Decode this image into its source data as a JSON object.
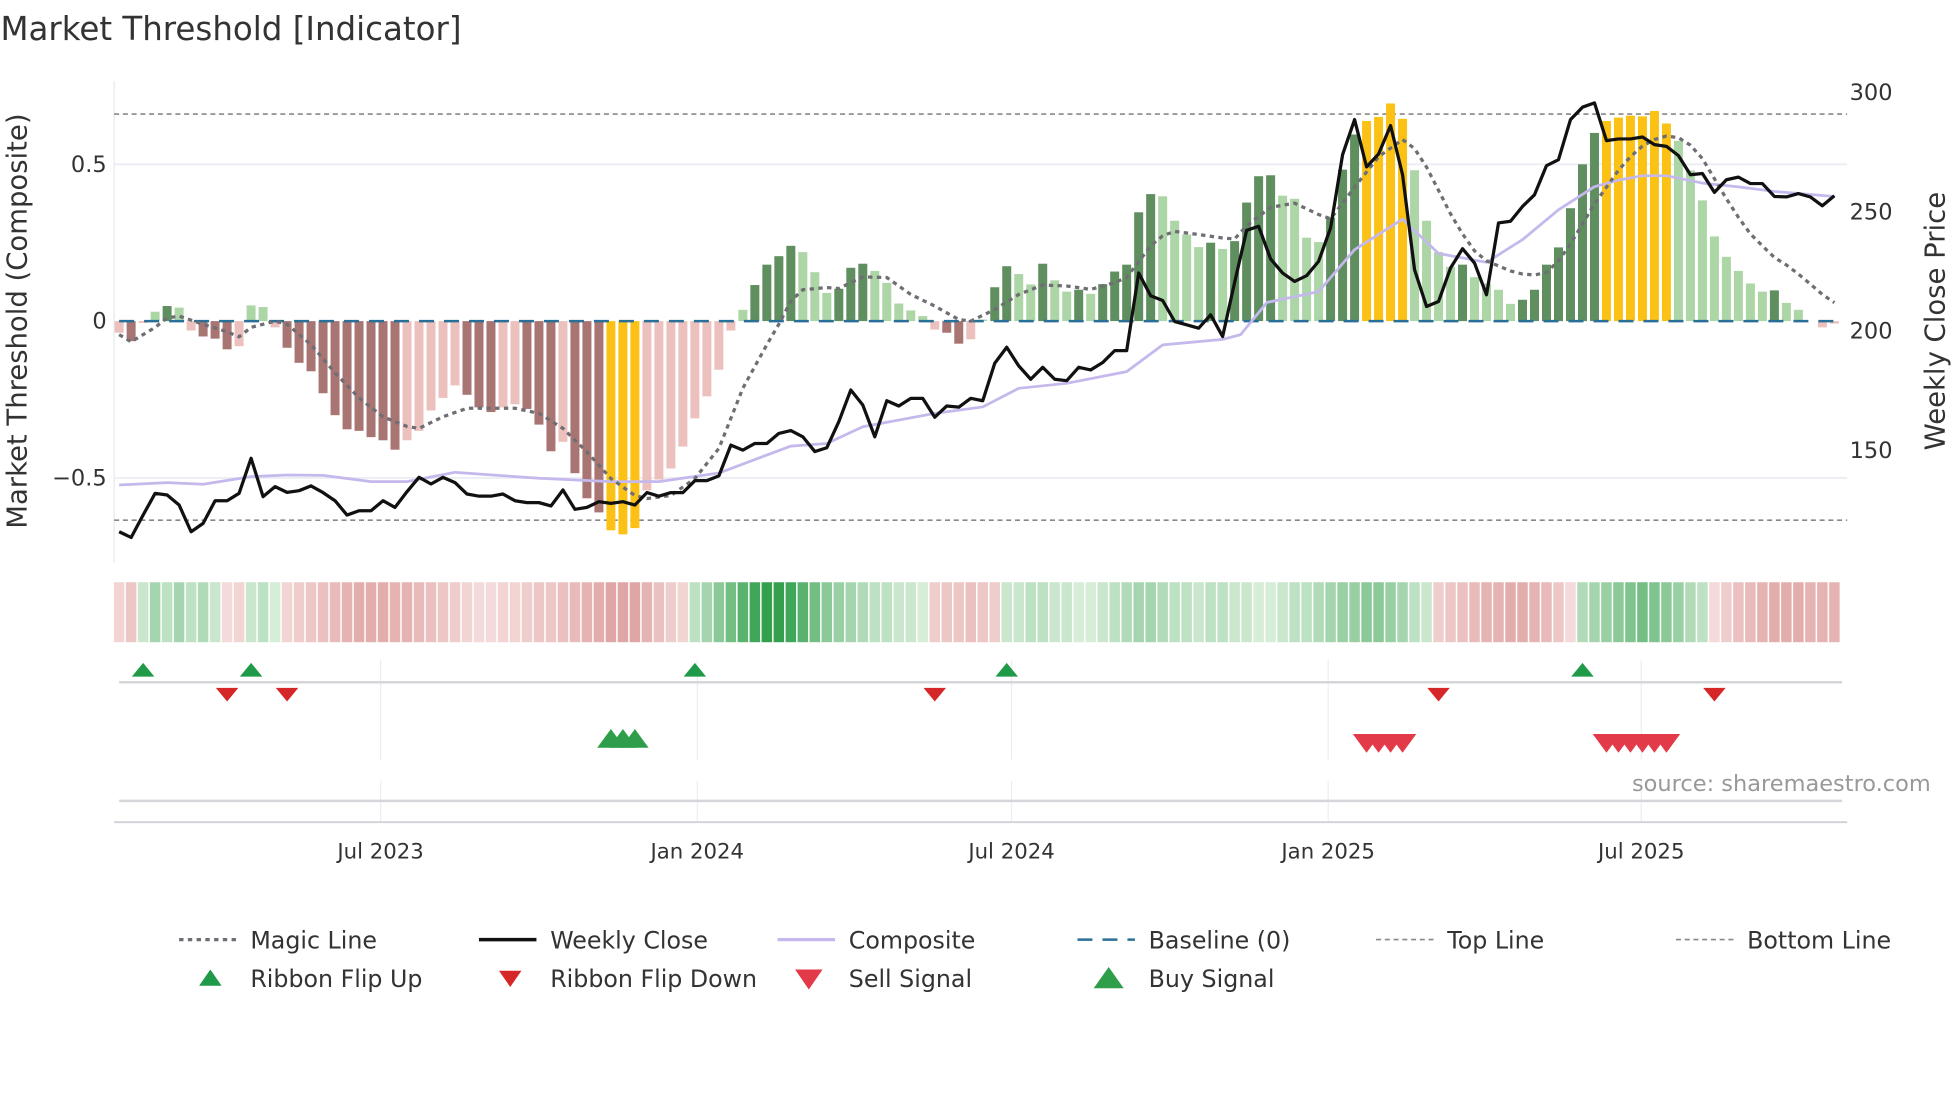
{
  "title": "Market Threshold [Indicator]",
  "source": "source: sharemaestro.com",
  "colors": {
    "dark_green": "#5f8f5f",
    "light_green": "#acd6a5",
    "dark_red": "#a87572",
    "light_red": "#ecc0bc",
    "extreme": "#fbc215",
    "weekly_close": "#111111",
    "composite": "#c4b8ec",
    "magic": "#6e6e74",
    "baseline": "#2a6f97",
    "threshold": "#888888",
    "flip_up": "#1f9a48",
    "flip_down": "#d62728",
    "sell": "#e23a48",
    "buy": "#2e9e4a"
  },
  "chart_data": {
    "type": "bar+line",
    "title": "Market Threshold [Indicator]",
    "ylabel_left": "Market Threshold (Composite)",
    "ylabel_right": "Weekly Close Price",
    "ylim_left": [
      -0.77,
      0.77
    ],
    "ylim_right": [
      113,
      313
    ],
    "left_ticks": [
      {
        "label": "0.5",
        "value": 0.5
      },
      {
        "label": "0",
        "value": 0
      },
      {
        "label": "−0.5",
        "value": -0.5
      }
    ],
    "right_ticks": [
      {
        "label": "300",
        "value": 300
      },
      {
        "label": "250",
        "value": 250
      },
      {
        "label": "200",
        "value": 200
      },
      {
        "label": "150",
        "value": 150
      }
    ],
    "x_ticks": [
      {
        "label": "Jul 2023",
        "week": 22.8
      },
      {
        "label": "Jan 2024",
        "week": 49.2
      },
      {
        "label": "Jul 2024",
        "week": 75.4
      },
      {
        "label": "Jan 2025",
        "week": 101.8
      },
      {
        "label": "Jul 2025",
        "week": 127.9
      }
    ],
    "weeks": 144,
    "top_line": 0.66,
    "bottom_line": -0.635,
    "baseline": 0,
    "histogram": [
      -0.037,
      -0.064,
      -0.006,
      0.03,
      0.048,
      0.043,
      -0.03,
      -0.049,
      -0.056,
      -0.09,
      -0.08,
      0.05,
      0.045,
      -0.02,
      -0.085,
      -0.133,
      -0.16,
      -0.23,
      -0.3,
      -0.345,
      -0.35,
      -0.37,
      -0.38,
      -0.41,
      -0.38,
      -0.35,
      -0.285,
      -0.245,
      -0.205,
      -0.235,
      -0.275,
      -0.29,
      -0.275,
      -0.265,
      -0.28,
      -0.33,
      -0.415,
      -0.385,
      -0.485,
      -0.565,
      -0.61,
      -0.667,
      -0.68,
      -0.66,
      -0.54,
      -0.505,
      -0.47,
      -0.4,
      -0.31,
      -0.24,
      -0.155,
      -0.03,
      0.036,
      0.115,
      0.18,
      0.207,
      0.24,
      0.22,
      0.156,
      0.09,
      0.103,
      0.17,
      0.183,
      0.16,
      0.122,
      0.056,
      0.034,
      0.016,
      -0.027,
      -0.037,
      -0.072,
      -0.058,
      0.005,
      0.108,
      0.175,
      0.15,
      0.117,
      0.183,
      0.13,
      0.094,
      0.1,
      0.087,
      0.118,
      0.158,
      0.18,
      0.347,
      0.405,
      0.398,
      0.32,
      0.276,
      0.236,
      0.25,
      0.23,
      0.255,
      0.378,
      0.462,
      0.465,
      0.4,
      0.39,
      0.266,
      0.252,
      0.33,
      0.483,
      0.595,
      0.638,
      0.651,
      0.694,
      0.645,
      0.481,
      0.32,
      0.22,
      0.173,
      0.18,
      0.14,
      0.12,
      0.1,
      0.055,
      0.068,
      0.1,
      0.18,
      0.235,
      0.36,
      0.5,
      0.6,
      0.638,
      0.649,
      0.655,
      0.653,
      0.67,
      0.63,
      0.575,
      0.48,
      0.385,
      0.27,
      0.205,
      0.16,
      0.12,
      0.094,
      0.098,
      0.058,
      0.036,
      0,
      -0.02,
      -0.008
    ],
    "histogram_state": [
      "lr",
      "dr",
      "lr",
      "lg",
      "dg",
      "lg",
      "lr",
      "dr",
      "dr",
      "dr",
      "lr",
      "lg",
      "lg",
      "lr",
      "dr",
      "dr",
      "dr",
      "dr",
      "dr",
      "dr",
      "dr",
      "dr",
      "dr",
      "dr",
      "lr",
      "lr",
      "lr",
      "lr",
      "lr",
      "dr",
      "dr",
      "dr",
      "lr",
      "lr",
      "dr",
      "dr",
      "dr",
      "lr",
      "dr",
      "dr",
      "dr",
      "y",
      "y",
      "y",
      "lr",
      "lr",
      "lr",
      "lr",
      "lr",
      "lr",
      "lr",
      "lr",
      "lg",
      "dg",
      "dg",
      "dg",
      "dg",
      "lg",
      "lg",
      "lg",
      "dg",
      "dg",
      "dg",
      "lg",
      "lg",
      "lg",
      "lg",
      "lg",
      "lr",
      "dr",
      "dr",
      "lr",
      "lg",
      "dg",
      "dg",
      "lg",
      "lg",
      "dg",
      "lg",
      "lg",
      "dg",
      "lg",
      "dg",
      "dg",
      "dg",
      "dg",
      "dg",
      "lg",
      "lg",
      "lg",
      "lg",
      "dg",
      "lg",
      "dg",
      "dg",
      "dg",
      "dg",
      "lg",
      "lg",
      "lg",
      "lg",
      "dg",
      "dg",
      "dg",
      "y",
      "y",
      "y",
      "y",
      "lg",
      "lg",
      "lg",
      "lg",
      "dg",
      "lg",
      "lg",
      "lg",
      "lg",
      "dg",
      "dg",
      "dg",
      "dg",
      "dg",
      "dg",
      "dg",
      "y",
      "y",
      "y",
      "y",
      "y",
      "y",
      "lg",
      "lg",
      "lg",
      "lg",
      "lg",
      "lg",
      "lg",
      "lg",
      "dg",
      "lg",
      "lg",
      "lg",
      "lr",
      "lr"
    ],
    "weekly_close": [
      115.4,
      113,
      122.4,
      131.5,
      130.8,
      126.6,
      115.4,
      118.9,
      128.4,
      128.4,
      131.5,
      146.2,
      130.1,
      134.3,
      131.9,
      132.6,
      134.6,
      131.8,
      128.4,
      122.4,
      124.2,
      124.2,
      128.4,
      125.6,
      132.2,
      138.2,
      135.4,
      138.2,
      136,
      131.2,
      130.3,
      130.3,
      131.2,
      128.4,
      127.6,
      127.6,
      126.2,
      132.9,
      124.8,
      125.6,
      128,
      127.3,
      128,
      126.6,
      131.8,
      130.3,
      131.8,
      131.8,
      136.8,
      136.8,
      138.8,
      151.7,
      149.6,
      152.4,
      152.4,
      156.6,
      157.8,
      155.2,
      149,
      150.6,
      161.5,
      174.8,
      168.5,
      155.2,
      170.3,
      168.1,
      171.3,
      171.3,
      163.4,
      168.1,
      167.6,
      171.3,
      170.3,
      186,
      192.7,
      184.9,
      179.3,
      184.3,
      179.3,
      178.7,
      184.3,
      183.2,
      186.3,
      191.3,
      191.3,
      223.8,
      214.3,
      212.3,
      203.5,
      202.1,
      200.7,
      206.3,
      197.2,
      219.9,
      241.7,
      243.4,
      229.7,
      223.8,
      220.3,
      222.7,
      228.7,
      242.7,
      273.4,
      288.1,
      268.3,
      273.7,
      285.6,
      265,
      225.2,
      209.8,
      211.9,
      225.9,
      234,
      228,
      214.7,
      244.8,
      245.5,
      251.7,
      256.6,
      268.8,
      271.3,
      288.1,
      293.3,
      295.1,
      279.3,
      280,
      280,
      280.8,
      277.6,
      276.9,
      273,
      265,
      265.5,
      257.6,
      262.9,
      264,
      261.3,
      261.3,
      255.9,
      255.7,
      257.1,
      255.7,
      252,
      256.2
    ],
    "composite": [
      [
        1,
        135
      ],
      [
        5,
        136
      ],
      [
        8,
        135.3
      ],
      [
        12,
        138.5
      ],
      [
        15,
        139.2
      ],
      [
        18,
        139
      ],
      [
        22,
        136.4
      ],
      [
        25,
        136.4
      ],
      [
        29,
        140.3
      ],
      [
        36,
        137.8
      ],
      [
        42,
        136.4
      ],
      [
        46,
        136.4
      ],
      [
        51,
        140
      ],
      [
        57,
        151.3
      ],
      [
        60,
        152.4
      ],
      [
        63,
        159.4
      ],
      [
        69,
        165
      ],
      [
        73,
        167.7
      ],
      [
        76,
        175.5
      ],
      [
        80,
        177.6
      ],
      [
        85,
        182.5
      ],
      [
        88,
        193.7
      ],
      [
        93,
        196
      ],
      [
        94.5,
        198
      ],
      [
        96.7,
        211.5
      ],
      [
        101,
        216
      ],
      [
        104,
        233.6
      ],
      [
        108,
        246.4
      ],
      [
        111,
        232
      ],
      [
        115,
        228.3
      ],
      [
        118,
        237.8
      ],
      [
        121,
        250.3
      ],
      [
        124,
        260
      ],
      [
        126,
        262.7
      ],
      [
        128,
        264.6
      ],
      [
        130,
        264.6
      ],
      [
        133,
        261.5
      ],
      [
        136,
        259.9
      ],
      [
        139,
        258
      ],
      [
        144,
        255.9
      ]
    ],
    "magic_line": [
      [
        1,
        -0.043
      ],
      [
        2,
        -0.066
      ],
      [
        4,
        -0.02
      ],
      [
        5,
        0.01
      ],
      [
        6,
        0.016
      ],
      [
        8,
        -0.01
      ],
      [
        10,
        -0.034
      ],
      [
        11,
        -0.05
      ],
      [
        12,
        -0.02
      ],
      [
        14,
        0
      ],
      [
        15,
        -0.01
      ],
      [
        17,
        -0.075
      ],
      [
        19,
        -0.165
      ],
      [
        21,
        -0.245
      ],
      [
        23,
        -0.305
      ],
      [
        25,
        -0.336
      ],
      [
        26,
        -0.342
      ],
      [
        28,
        -0.305
      ],
      [
        30,
        -0.278
      ],
      [
        32,
        -0.278
      ],
      [
        34,
        -0.278
      ],
      [
        36,
        -0.294
      ],
      [
        38,
        -0.342
      ],
      [
        40,
        -0.417
      ],
      [
        42,
        -0.502
      ],
      [
        44,
        -0.556
      ],
      [
        45,
        -0.566
      ],
      [
        47,
        -0.556
      ],
      [
        49,
        -0.502
      ],
      [
        51,
        -0.406
      ],
      [
        53,
        -0.214
      ],
      [
        55,
        -0.075
      ],
      [
        56,
        -0.01
      ],
      [
        57,
        0.064
      ],
      [
        58,
        0.1
      ],
      [
        60,
        0.107
      ],
      [
        61,
        0.104
      ],
      [
        63,
        0.141
      ],
      [
        65,
        0.139
      ],
      [
        67,
        0.085
      ],
      [
        69,
        0.048
      ],
      [
        71,
        0.005
      ],
      [
        72,
        0
      ],
      [
        74,
        0.037
      ],
      [
        76,
        0.085
      ],
      [
        78,
        0.115
      ],
      [
        80,
        0.112
      ],
      [
        82,
        0.101
      ],
      [
        84,
        0.123
      ],
      [
        85,
        0.139
      ],
      [
        87,
        0.24
      ],
      [
        88,
        0.272
      ],
      [
        89,
        0.286
      ],
      [
        91,
        0.276
      ],
      [
        93,
        0.265
      ],
      [
        94,
        0.262
      ],
      [
        95,
        0.304
      ],
      [
        97,
        0.363
      ],
      [
        99,
        0.376
      ],
      [
        101,
        0.34
      ],
      [
        102,
        0.326
      ],
      [
        104,
        0.427
      ],
      [
        106,
        0.524
      ],
      [
        108,
        0.579
      ],
      [
        109,
        0.55
      ],
      [
        110,
        0.491
      ],
      [
        111,
        0.417
      ],
      [
        112,
        0.342
      ],
      [
        113,
        0.278
      ],
      [
        114,
        0.224
      ],
      [
        115,
        0.192
      ],
      [
        116,
        0.176
      ],
      [
        117,
        0.16
      ],
      [
        118,
        0.15
      ],
      [
        119,
        0.147
      ],
      [
        120,
        0.155
      ],
      [
        121,
        0.192
      ],
      [
        122,
        0.246
      ],
      [
        123,
        0.31
      ],
      [
        124,
        0.374
      ],
      [
        125,
        0.427
      ],
      [
        126,
        0.481
      ],
      [
        127,
        0.524
      ],
      [
        128,
        0.558
      ],
      [
        129,
        0.579
      ],
      [
        130,
        0.59
      ],
      [
        131,
        0.585
      ],
      [
        132,
        0.561
      ],
      [
        133,
        0.518
      ],
      [
        134,
        0.454
      ],
      [
        135,
        0.39
      ],
      [
        136,
        0.331
      ],
      [
        137,
        0.278
      ],
      [
        138,
        0.24
      ],
      [
        139,
        0.203
      ],
      [
        140,
        0.179
      ],
      [
        141,
        0.15
      ],
      [
        142,
        0.118
      ],
      [
        143,
        0.085
      ],
      [
        144,
        0.059
      ]
    ],
    "ribbon": [
      -0.25,
      -0.35,
      0.25,
      0.4,
      0.3,
      0.4,
      0.3,
      0.35,
      0.25,
      -0.2,
      -0.25,
      0.25,
      0.3,
      0.2,
      -0.25,
      -0.3,
      -0.35,
      -0.4,
      -0.45,
      -0.5,
      -0.55,
      -0.55,
      -0.55,
      -0.5,
      -0.5,
      -0.45,
      -0.4,
      -0.35,
      -0.3,
      -0.25,
      -0.2,
      -0.2,
      -0.25,
      -0.25,
      -0.3,
      -0.35,
      -0.35,
      -0.4,
      -0.45,
      -0.5,
      -0.55,
      -0.6,
      -0.6,
      -0.6,
      -0.5,
      -0.4,
      -0.3,
      -0.25,
      0.3,
      0.4,
      0.5,
      0.6,
      0.7,
      0.8,
      0.85,
      0.85,
      0.8,
      0.7,
      0.6,
      0.5,
      0.45,
      0.4,
      0.35,
      0.3,
      0.3,
      0.25,
      0.25,
      0.2,
      -0.3,
      -0.35,
      -0.35,
      -0.4,
      -0.35,
      -0.3,
      0.25,
      0.25,
      0.3,
      0.3,
      0.25,
      0.25,
      0.2,
      0.2,
      0.25,
      0.3,
      0.35,
      0.4,
      0.4,
      0.35,
      0.3,
      0.3,
      0.25,
      0.3,
      0.3,
      0.25,
      0.25,
      0.2,
      0.2,
      0.25,
      0.3,
      0.3,
      0.35,
      0.4,
      0.45,
      0.45,
      0.5,
      0.5,
      0.45,
      0.4,
      0.3,
      0.25,
      -0.3,
      -0.35,
      -0.4,
      -0.45,
      -0.5,
      -0.5,
      -0.55,
      -0.55,
      -0.5,
      -0.45,
      -0.35,
      -0.2,
      0.35,
      0.4,
      0.45,
      0.5,
      0.55,
      0.6,
      0.55,
      0.5,
      0.45,
      0.35,
      0.3,
      -0.2,
      -0.3,
      -0.4,
      -0.45,
      -0.5,
      -0.55,
      -0.55,
      -0.55,
      -0.5,
      -0.5,
      -0.5
    ],
    "ribbon_flip_up_weeks": [
      3,
      12,
      49,
      75,
      123
    ],
    "ribbon_flip_down_weeks": [
      10,
      15,
      69,
      111,
      134
    ],
    "buy_signal_weeks": [
      42,
      43,
      44
    ],
    "sell_signal_weeks": [
      105,
      106,
      107,
      108,
      125,
      126,
      127,
      128,
      129,
      130
    ],
    "legend_placement": "bottom",
    "legend": [
      {
        "label": "Magic Line",
        "key": "magic"
      },
      {
        "label": "Weekly Close",
        "key": "close"
      },
      {
        "label": "Composite",
        "key": "composite"
      },
      {
        "label": "Baseline (0)",
        "key": "baseline"
      },
      {
        "label": "Top Line",
        "key": "top"
      },
      {
        "label": "Bottom Line",
        "key": "bottom"
      },
      {
        "label": "Ribbon Flip Up",
        "key": "flipup"
      },
      {
        "label": "Ribbon Flip Down",
        "key": "flipdown"
      },
      {
        "label": "Sell Signal",
        "key": "sell"
      },
      {
        "label": "Buy Signal",
        "key": "buy"
      }
    ]
  }
}
